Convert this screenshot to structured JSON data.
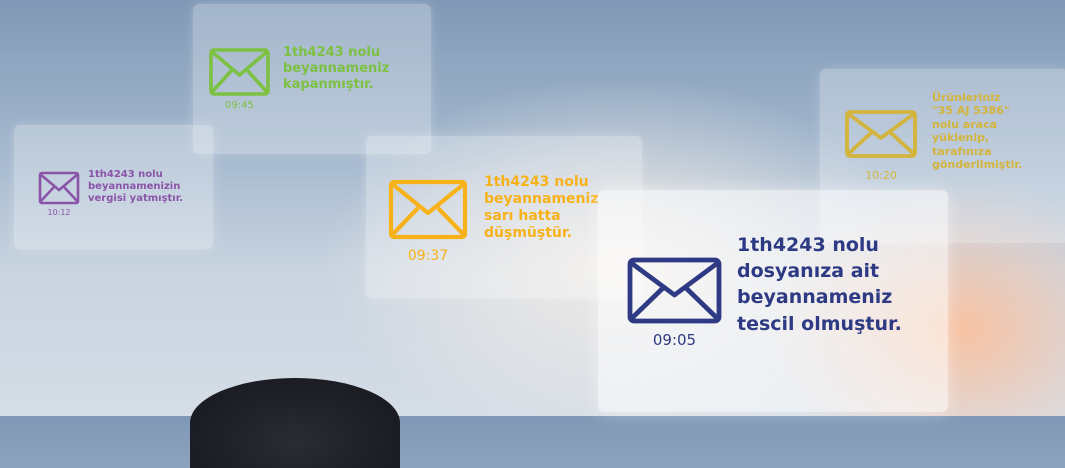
{
  "notifications": [
    {
      "id": "purple",
      "time": "10:12",
      "lines": [
        "1th4243 nolu",
        "beyannamenizin",
        "vergisi yatmıştır."
      ],
      "color": "#8a54a8"
    },
    {
      "id": "green",
      "time": "09:45",
      "lines": [
        "1th4243 nolu",
        "beyannameniz",
        "kapanmıştır."
      ],
      "color": "#7cc142"
    },
    {
      "id": "orange",
      "time": "09:37",
      "lines": [
        "1th4243 nolu",
        "beyannameniz",
        "sarı hatta",
        "düşmüştür."
      ],
      "color": "#f7b21a"
    },
    {
      "id": "yellow",
      "time": "10:20",
      "lines": [
        "Ürünleriniz",
        "\"35 AJ 5386\"",
        "nolu araca",
        "yüklenip,",
        "tarafınıza",
        "gönderilmiştir."
      ],
      "color": "#d3b43c"
    },
    {
      "id": "navy",
      "time": "09:05",
      "lines": [
        "1th4243 nolu",
        "dosyanıza ait",
        "beyannameniz",
        "tescil olmuştur."
      ],
      "color": "#2e3a83"
    }
  ]
}
